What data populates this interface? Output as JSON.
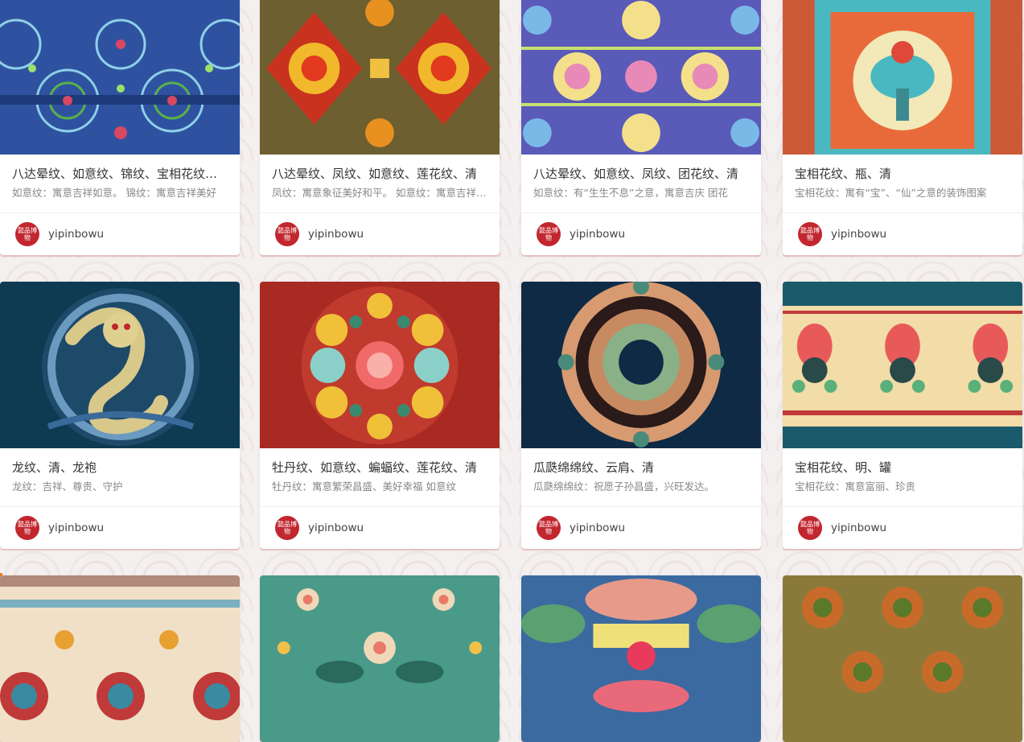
{
  "avatar_text": "懿品博物",
  "cards": [
    {
      "title": "八达晕纹、如意纹、锦纹、宝相花纹、清",
      "desc": "如意纹：寓意吉祥如意。 锦纹：寓意吉祥美好",
      "author": "yipinbowu"
    },
    {
      "title": "八达晕纹、凤纹、如意纹、莲花纹、清",
      "desc": "凤纹：寓意象征美好和平。 如意纹：寓意吉祥如意",
      "author": "yipinbowu"
    },
    {
      "title": "八达晕纹、如意纹、凤纹、团花纹、清",
      "desc": "如意纹：有“生生不息”之意，寓意吉庆 团花",
      "author": "yipinbowu"
    },
    {
      "title": "宝相花纹、瓶、清",
      "desc": "宝相花纹：寓有“宝”、“仙”之意的装饰图案",
      "author": "yipinbowu"
    },
    {
      "title": "龙纹、清、龙袍",
      "desc": "龙纹：吉祥、尊贵、守护",
      "author": "yipinbowu"
    },
    {
      "title": "牡丹纹、如意纹、蝙蝠纹、莲花纹、清",
      "desc": "牡丹纹：寓意繁荣昌盛、美好幸福 如意纹",
      "author": "yipinbowu"
    },
    {
      "title": "瓜瓞绵绵纹、云肩、清",
      "desc": "瓜瓞绵绵纹：祝愿子孙昌盛，兴旺发达。",
      "author": "yipinbowu"
    },
    {
      "title": "宝相花纹、明、罐",
      "desc": "宝相花纹：寓意富丽、珍贵",
      "author": "yipinbowu"
    },
    {
      "title": "",
      "desc": "",
      "author": ""
    },
    {
      "title": "",
      "desc": "",
      "author": ""
    },
    {
      "title": "",
      "desc": "",
      "author": ""
    },
    {
      "title": "",
      "desc": "",
      "author": ""
    }
  ]
}
